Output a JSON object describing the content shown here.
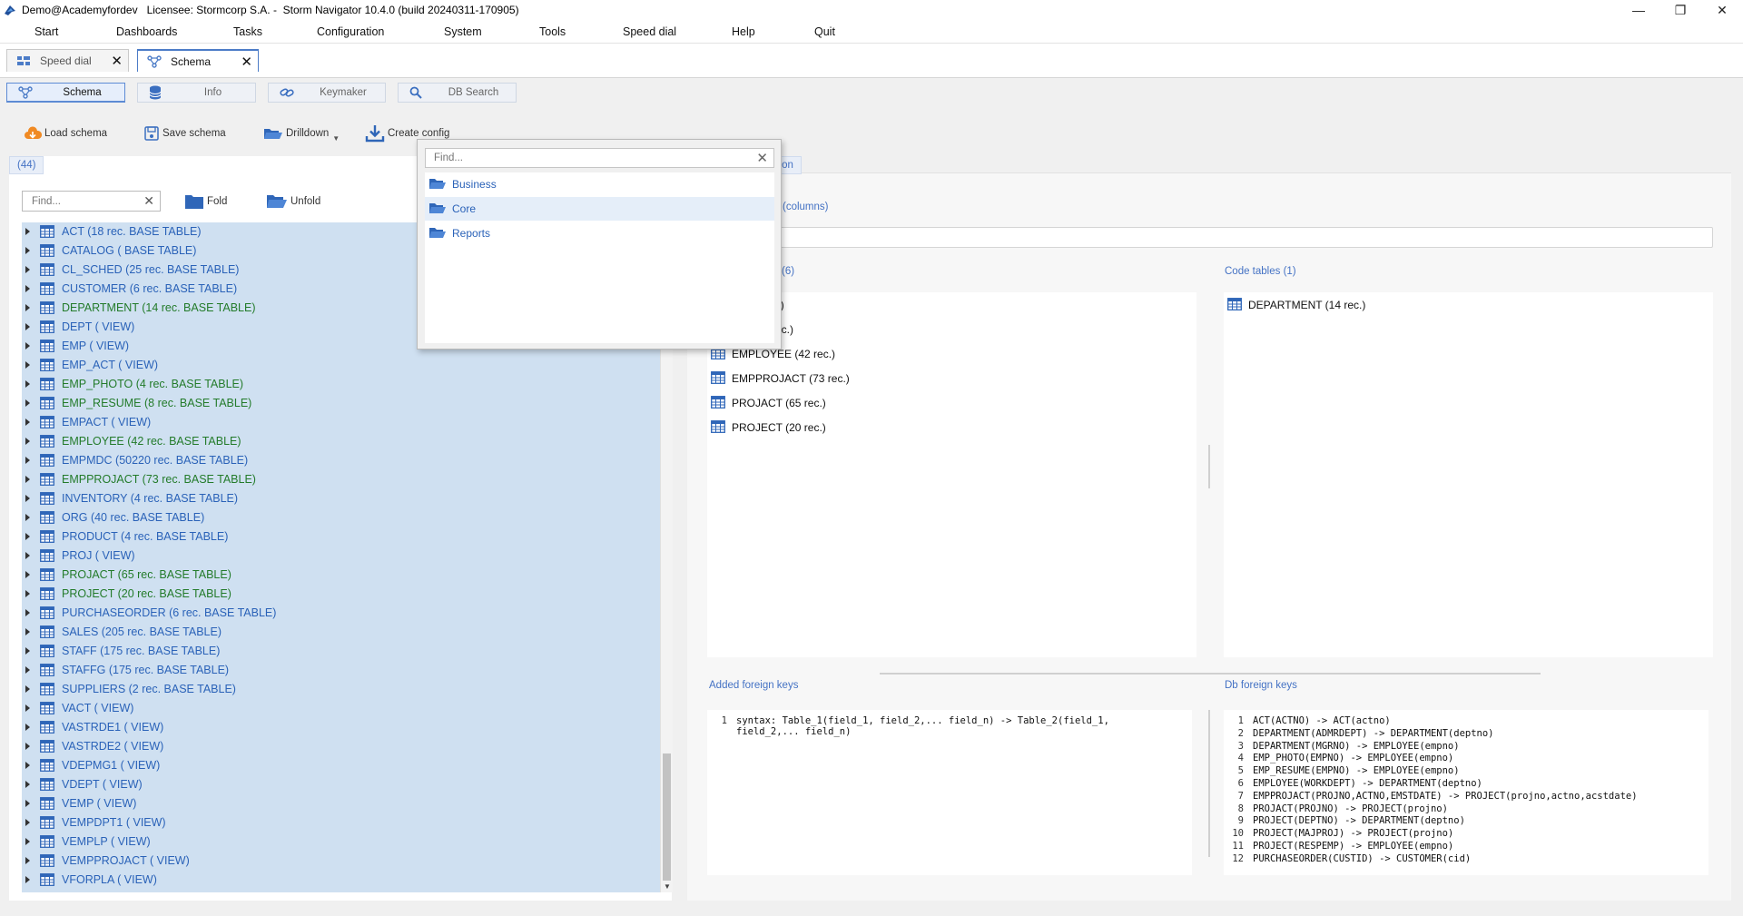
{
  "window": {
    "title": "Demo@Academyfordev   Licensee: Stormcorp S.A. -  Storm Navigator 10.4.0 (build 20240311-170905)",
    "controls": [
      "—",
      "❐",
      "✕"
    ]
  },
  "menu": [
    "Start",
    "Dashboards",
    "Tasks",
    "Configuration",
    "System",
    "Tools",
    "Speed dial",
    "Help",
    "Quit"
  ],
  "doc_tabs": [
    {
      "label": "Speed dial",
      "icon": "dashboard-icon",
      "active": false
    },
    {
      "label": "Schema",
      "icon": "schema-icon",
      "active": true
    }
  ],
  "sub_tabs": [
    {
      "label": "Schema",
      "icon": "schema-icon",
      "active": true
    },
    {
      "label": "Info",
      "icon": "database-icon",
      "active": false
    },
    {
      "label": "Keymaker",
      "icon": "link-icon",
      "active": false
    },
    {
      "label": "DB Search",
      "icon": "search-icon",
      "active": false
    }
  ],
  "toolbar": {
    "load": "Load schema",
    "save": "Save schema",
    "drilldown": "Drilldown",
    "create": "Create config"
  },
  "left": {
    "count": "(44)",
    "find_placeholder": "Find...",
    "fold": "Fold",
    "unfold": "Unfold",
    "items": [
      {
        "label": "ACT (18 rec. BASE TABLE)",
        "color": "blue"
      },
      {
        "label": "CATALOG ( BASE TABLE)",
        "color": "blue"
      },
      {
        "label": "CL_SCHED (25 rec. BASE TABLE)",
        "color": "blue"
      },
      {
        "label": "CUSTOMER (6 rec. BASE TABLE)",
        "color": "blue"
      },
      {
        "label": "DEPARTMENT (14 rec. BASE TABLE)",
        "color": "green"
      },
      {
        "label": "DEPT ( VIEW)",
        "color": "blue"
      },
      {
        "label": "EMP ( VIEW)",
        "color": "blue"
      },
      {
        "label": "EMP_ACT ( VIEW)",
        "color": "blue"
      },
      {
        "label": "EMP_PHOTO (4 rec. BASE TABLE)",
        "color": "green"
      },
      {
        "label": "EMP_RESUME (8 rec. BASE TABLE)",
        "color": "green"
      },
      {
        "label": "EMPACT ( VIEW)",
        "color": "blue"
      },
      {
        "label": "EMPLOYEE (42 rec. BASE TABLE)",
        "color": "green"
      },
      {
        "label": "EMPMDC (50220 rec. BASE TABLE)",
        "color": "blue"
      },
      {
        "label": "EMPPROJACT (73 rec. BASE TABLE)",
        "color": "green"
      },
      {
        "label": "INVENTORY (4 rec. BASE TABLE)",
        "color": "blue"
      },
      {
        "label": "ORG (40 rec. BASE TABLE)",
        "color": "blue"
      },
      {
        "label": "PRODUCT (4 rec. BASE TABLE)",
        "color": "blue"
      },
      {
        "label": "PROJ ( VIEW)",
        "color": "blue"
      },
      {
        "label": "PROJACT (65 rec. BASE TABLE)",
        "color": "green"
      },
      {
        "label": "PROJECT (20 rec. BASE TABLE)",
        "color": "green"
      },
      {
        "label": "PURCHASEORDER (6 rec. BASE TABLE)",
        "color": "blue"
      },
      {
        "label": "SALES (205 rec. BASE TABLE)",
        "color": "blue"
      },
      {
        "label": "STAFF (175 rec. BASE TABLE)",
        "color": "blue"
      },
      {
        "label": "STAFFG (175 rec. BASE TABLE)",
        "color": "blue"
      },
      {
        "label": "SUPPLIERS (2 rec. BASE TABLE)",
        "color": "blue"
      },
      {
        "label": "VACT ( VIEW)",
        "color": "blue"
      },
      {
        "label": "VASTRDE1 ( VIEW)",
        "color": "blue"
      },
      {
        "label": "VASTRDE2 ( VIEW)",
        "color": "blue"
      },
      {
        "label": "VDEPMG1 ( VIEW)",
        "color": "blue"
      },
      {
        "label": "VDEPT ( VIEW)",
        "color": "blue"
      },
      {
        "label": "VEMP ( VIEW)",
        "color": "blue"
      },
      {
        "label": "VEMPDPT1 ( VIEW)",
        "color": "blue"
      },
      {
        "label": "VEMPLP ( VIEW)",
        "color": "blue"
      },
      {
        "label": "VEMPPROJACT ( VIEW)",
        "color": "blue"
      },
      {
        "label": "VFORPLA ( VIEW)",
        "color": "blue"
      }
    ]
  },
  "right": {
    "tab_label": "ation",
    "columns_link": "(columns)",
    "tables_label": "(6)",
    "code_tables_label": "Code tables (1)",
    "tables": [
      "TO (4 rec.)",
      "UME (8 rec.)",
      "EMPLOYEE (42 rec.)",
      "EMPPROJACT (73 rec.)",
      "PROJACT (65 rec.)",
      "PROJECT (20 rec.)"
    ],
    "code_tables": [
      "DEPARTMENT (14 rec.)"
    ],
    "added_fk_label": "Added foreign keys",
    "db_fk_label": "Db foreign keys",
    "added_fk_syntax": "syntax: Table_1(field_1, field_2,... field_n) -> Table_2(field_1,\nfield_2,... field_n)",
    "db_fks": [
      "ACT(ACTNO) -> ACT(actno)",
      "DEPARTMENT(ADMRDEPT) -> DEPARTMENT(deptno)",
      "DEPARTMENT(MGRNO) -> EMPLOYEE(empno)",
      "EMP_PHOTO(EMPNO) -> EMPLOYEE(empno)",
      "EMP_RESUME(EMPNO) -> EMPLOYEE(empno)",
      "EMPLOYEE(WORKDEPT) -> DEPARTMENT(deptno)",
      "EMPPROJACT(PROJNO,ACTNO,EMSTDATE) -> PROJECT(projno,actno,acstdate)",
      "PROJACT(PROJNO) -> PROJECT(projno)",
      "PROJECT(DEPTNO) -> DEPARTMENT(deptno)",
      "PROJECT(MAJPROJ) -> PROJECT(projno)",
      "PROJECT(RESPEMP) -> EMPLOYEE(empno)",
      "PURCHASEORDER(CUSTID) -> CUSTOMER(cid)"
    ]
  },
  "popup": {
    "find_placeholder": "Find...",
    "items": [
      {
        "label": "Business",
        "selected": false
      },
      {
        "label": "Core",
        "selected": true
      },
      {
        "label": "Reports",
        "selected": false
      }
    ]
  },
  "colors": {
    "accent": "#4472c4",
    "tree_bg": "#cfe0f1",
    "green": "#237b2a",
    "blue": "#2a62b8"
  }
}
